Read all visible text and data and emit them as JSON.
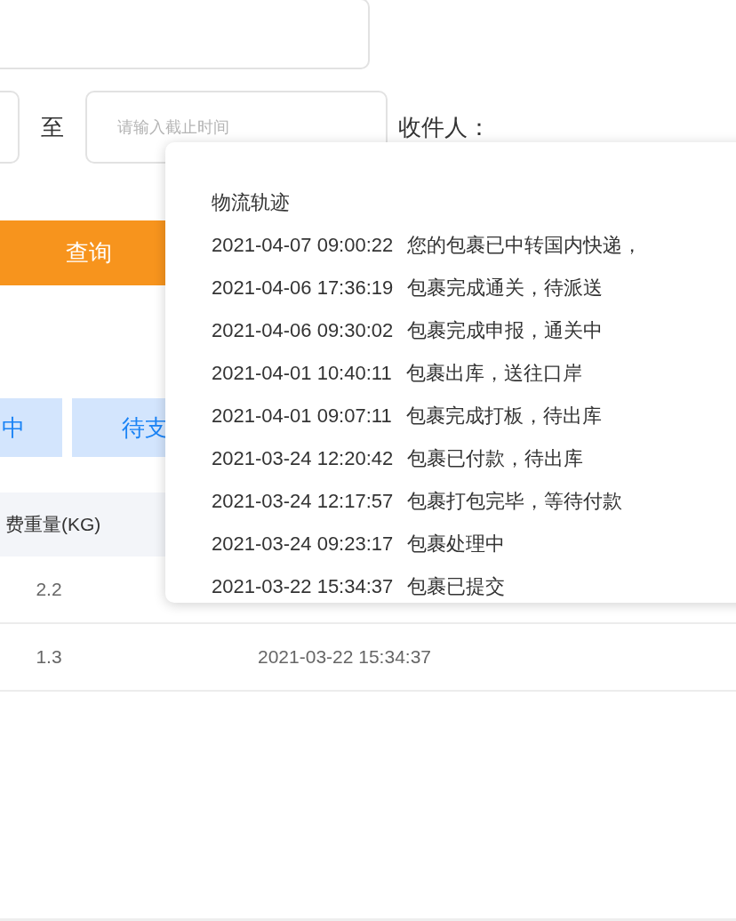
{
  "date_range": {
    "separator": "至",
    "end_placeholder": "请输入截止时间"
  },
  "recipient_label": "收件人：",
  "query_button": "查询",
  "status_tabs": [
    {
      "label": "中",
      "selected": false
    },
    {
      "label": "待支",
      "selected": false
    }
  ],
  "table": {
    "columns": [
      "费重量(KG)"
    ],
    "rows": [
      [
        "2.2"
      ],
      [
        "1.3",
        "2021-03-22 15:34:37"
      ]
    ]
  },
  "tracking_popup": {
    "title": "物流轨迹",
    "events": [
      {
        "time": "2021-04-07 09:00:22",
        "text": "您的包裹已中转国内快递，"
      },
      {
        "time": "2021-04-06 17:36:19",
        "text": "包裹完成通关，待派送"
      },
      {
        "time": "2021-04-06 09:30:02",
        "text": "包裹完成申报，通关中"
      },
      {
        "time": "2021-04-01 10:40:11",
        "text": "包裹出库，送往口岸"
      },
      {
        "time": "2021-04-01 09:07:11",
        "text": "包裹完成打板，待出库"
      },
      {
        "time": "2021-03-24 12:20:42",
        "text": "包裹已付款，待出库"
      },
      {
        "time": "2021-03-24 12:17:57",
        "text": "包裹打包完毕，等待付款"
      },
      {
        "time": "2021-03-24 09:23:17",
        "text": "包裹处理中"
      },
      {
        "time": "2021-03-22 15:34:37",
        "text": "包裹已提交"
      }
    ]
  }
}
